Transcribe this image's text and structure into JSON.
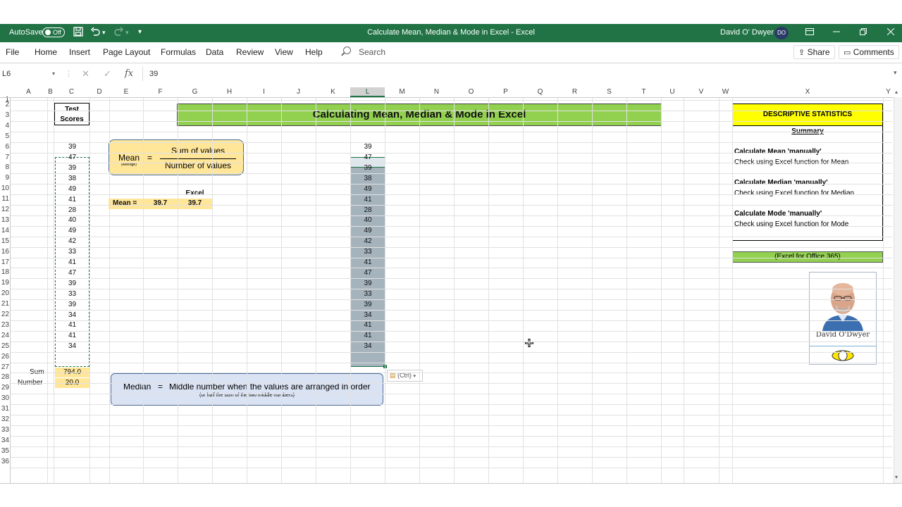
{
  "titlebar": {
    "autosave_label": "AutoSave",
    "autosave_state": "Off",
    "doc_title": "Calculate Mean, Median & Mode in Excel  -  Excel",
    "user_name": "David O' Dwyer",
    "user_initials": "DO",
    "save_icon": "save-icon",
    "undo_icon": "undo-icon",
    "redo_icon": "redo-icon"
  },
  "ribbon": {
    "tabs": [
      "File",
      "Home",
      "Insert",
      "Page Layout",
      "Formulas",
      "Data",
      "Review",
      "View",
      "Help"
    ],
    "search_placeholder": "Search",
    "share_label": "Share",
    "comments_label": "Comments"
  },
  "formula_bar": {
    "name_box": "L6",
    "value": "39"
  },
  "columns": [
    "A",
    "B",
    "C",
    "D",
    "E",
    "F",
    "G",
    "H",
    "I",
    "J",
    "K",
    "L",
    "M",
    "N",
    "O",
    "P",
    "Q",
    "R",
    "S",
    "T",
    "U",
    "V",
    "W",
    "X",
    "Y"
  ],
  "selected_column": "L",
  "rows": [
    "1",
    "2",
    "3",
    "4",
    "5",
    "6",
    "7",
    "8",
    "9",
    "10",
    "11",
    "12",
    "13",
    "14",
    "15",
    "16",
    "17",
    "18",
    "19",
    "20",
    "21",
    "22",
    "23",
    "24",
    "25",
    "26",
    "27",
    "28",
    "29",
    "30",
    "31",
    "32",
    "33",
    "34",
    "35",
    "36"
  ],
  "test_scores": {
    "header": "Test\nScores",
    "header_line1": "Test",
    "header_line2": "Scores",
    "values": [
      "39",
      "47",
      "39",
      "38",
      "49",
      "41",
      "28",
      "40",
      "49",
      "42",
      "33",
      "41",
      "47",
      "39",
      "33",
      "39",
      "34",
      "41",
      "41",
      "34"
    ],
    "sum_label": "Sum",
    "sum_value": "794.0",
    "number_label": "Number",
    "number_value": "20.0"
  },
  "copy_column": {
    "values": [
      "39",
      "47",
      "39",
      "38",
      "49",
      "41",
      "28",
      "40",
      "49",
      "42",
      "33",
      "41",
      "47",
      "39",
      "33",
      "39",
      "34",
      "41",
      "41",
      "34"
    ],
    "paste_options": "(Ctrl)"
  },
  "title_banner": "Calculating Mean, Median & Mode in Excel",
  "mean_box": {
    "label": "Mean",
    "sublabel": "(Average)",
    "equals": "=",
    "numerator": "Sum of values",
    "denominator": "Number of values"
  },
  "mean_calc": {
    "excel_header": "Excel",
    "label": "Mean =",
    "manual_value": "39.7",
    "excel_value": "39.7"
  },
  "median_box": {
    "label": "Median",
    "equals": "=",
    "text": "Middle number when the values are arranged in order",
    "subtext": "(or half the sum of the two middle numbers)"
  },
  "stats_panel": {
    "title": "DESCRIPTIVE STATISTICS",
    "summary": "Summary",
    "items": [
      {
        "heading": "Calculate Mean 'manually'",
        "detail": "Check using Excel function for Mean"
      },
      {
        "heading": "Calculate Median 'manually'",
        "detail": "Check using Excel function for Median"
      },
      {
        "heading": "Calculate Mode 'manually'",
        "detail": "Check using Excel function for Mode"
      }
    ],
    "office_note": "(Excel for Office 365)"
  },
  "author_card": {
    "name": "David O'Dwyer"
  },
  "colors": {
    "excel_green": "#217346",
    "banner_green": "#92d050",
    "stats_yellow": "#ffff00",
    "mean_box_fill": "#ffe699",
    "median_box_fill": "#dae3f3",
    "selection_fill": "#a5b3bd"
  }
}
